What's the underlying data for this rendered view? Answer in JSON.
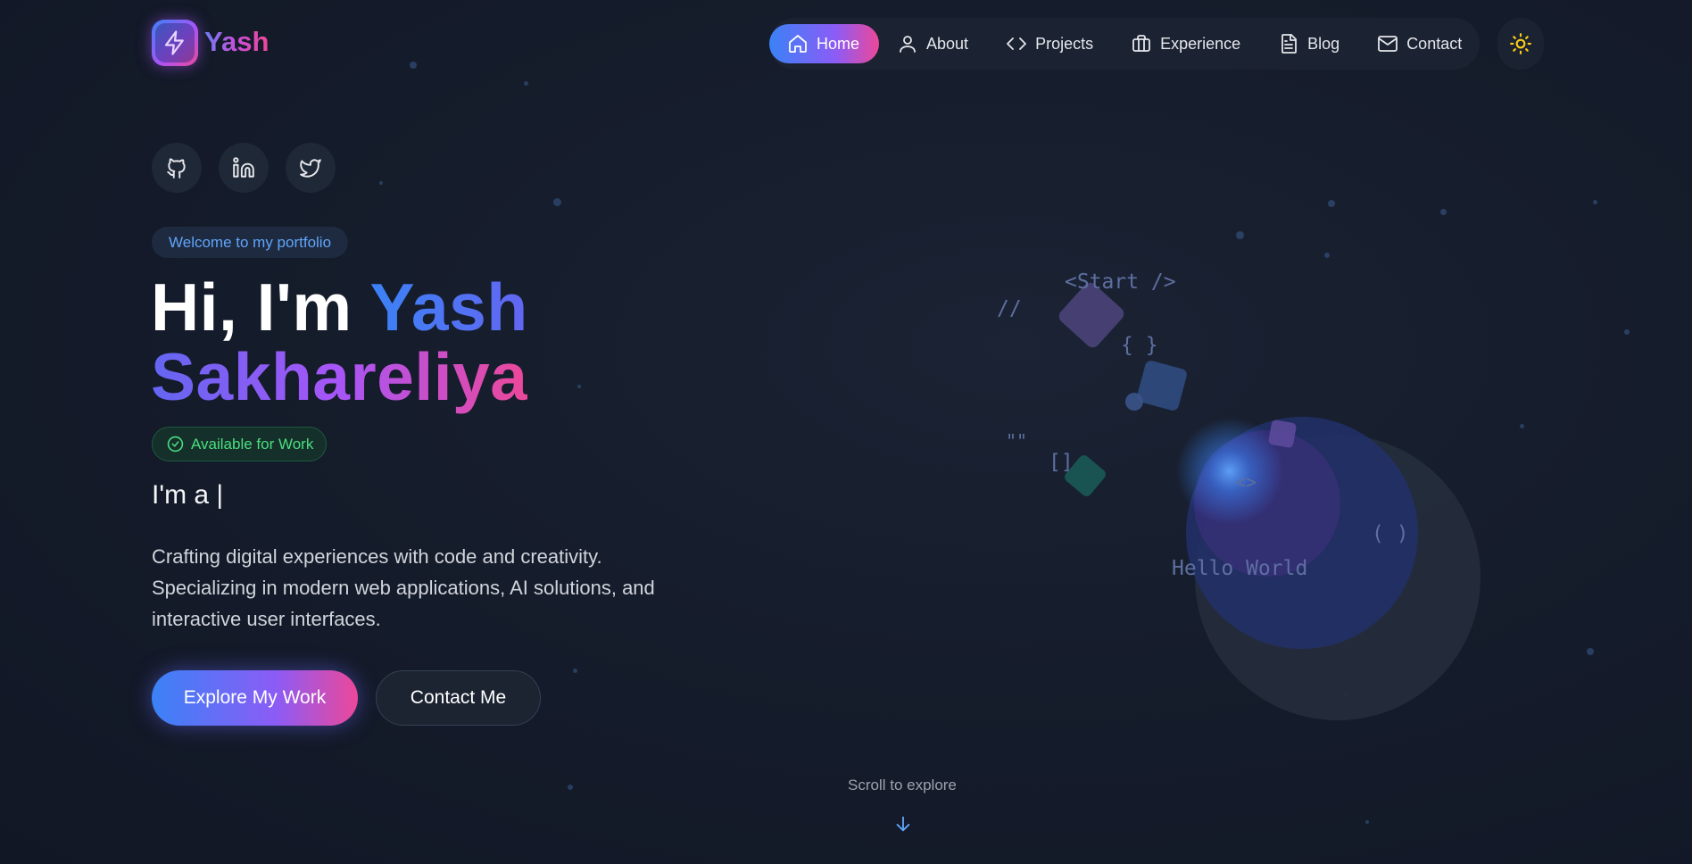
{
  "brand": {
    "name": "Yash",
    "logo_icon": "lightning-icon"
  },
  "nav": {
    "items": [
      {
        "label": "Home",
        "icon": "home-icon",
        "active": true
      },
      {
        "label": "About",
        "icon": "user-icon",
        "active": false
      },
      {
        "label": "Projects",
        "icon": "code-icon",
        "active": false
      },
      {
        "label": "Experience",
        "icon": "briefcase-icon",
        "active": false
      },
      {
        "label": "Blog",
        "icon": "document-icon",
        "active": false
      },
      {
        "label": "Contact",
        "icon": "mail-icon",
        "active": false
      }
    ],
    "theme_icon": "sun-icon"
  },
  "socials": [
    {
      "icon": "github-icon"
    },
    {
      "icon": "linkedin-icon"
    },
    {
      "icon": "twitter-icon"
    }
  ],
  "hero": {
    "welcome": "Welcome to my portfolio",
    "greeting": "Hi, I'm ",
    "first_name": "Yash",
    "last_name": "Sakhareliya",
    "availability": "Available for Work",
    "typer": "I'm a |",
    "description": "Crafting digital experiences with code and creativity. Specializing in modern web applications, AI solutions, and interactive user interfaces.",
    "primary_cta": "Explore My Work",
    "secondary_cta": "Contact Me",
    "scroll_hint": "Scroll to explore"
  },
  "art": {
    "start_tag": "<Start />",
    "comment": "//",
    "braces": "{ }",
    "quotes": "\"\"",
    "brackets": "[]",
    "angle": "<>",
    "parens": "( )",
    "hello": "Hello World"
  },
  "colors": {
    "accent_blue": "#3b82f6",
    "accent_purple": "#8b5cf6",
    "accent_pink": "#ec4899",
    "success": "#4ade80",
    "sun": "#facc15"
  }
}
